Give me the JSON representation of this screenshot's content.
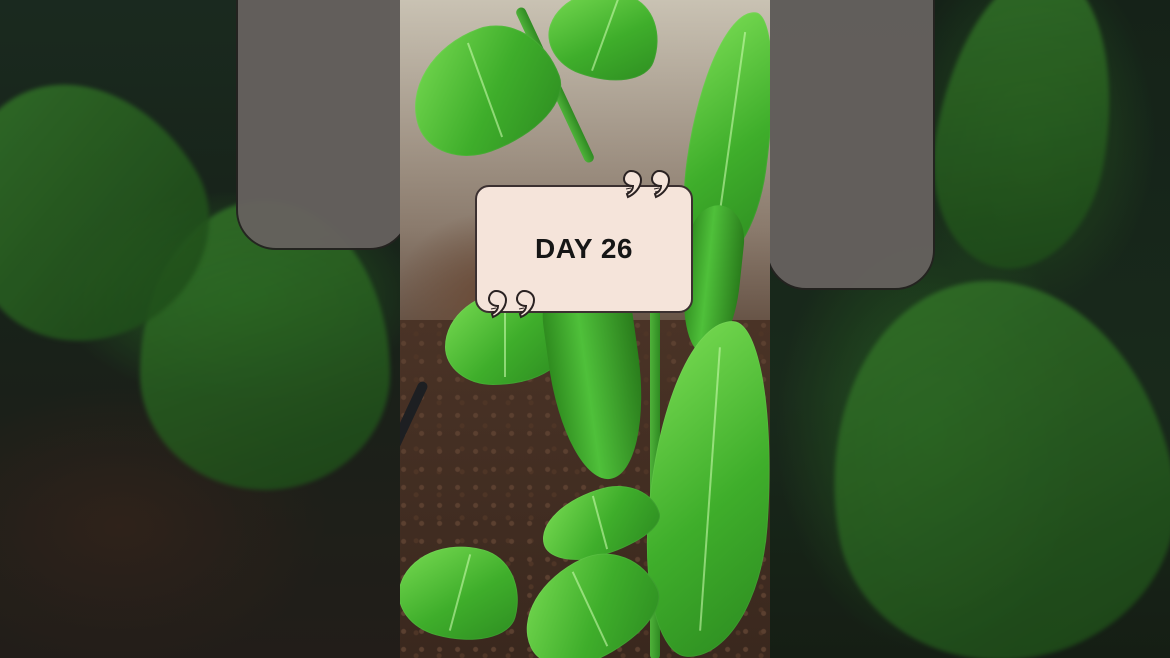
{
  "overlay": {
    "title": "DAY 26"
  },
  "icons": {
    "open_quote": "quote-open-icon",
    "close_quote": "quote-close-icon"
  },
  "colors": {
    "card_background": "#f5e4da",
    "card_border": "#3b3030",
    "leaf_green": "#4fc03a",
    "soil_brown": "#3a281e"
  }
}
